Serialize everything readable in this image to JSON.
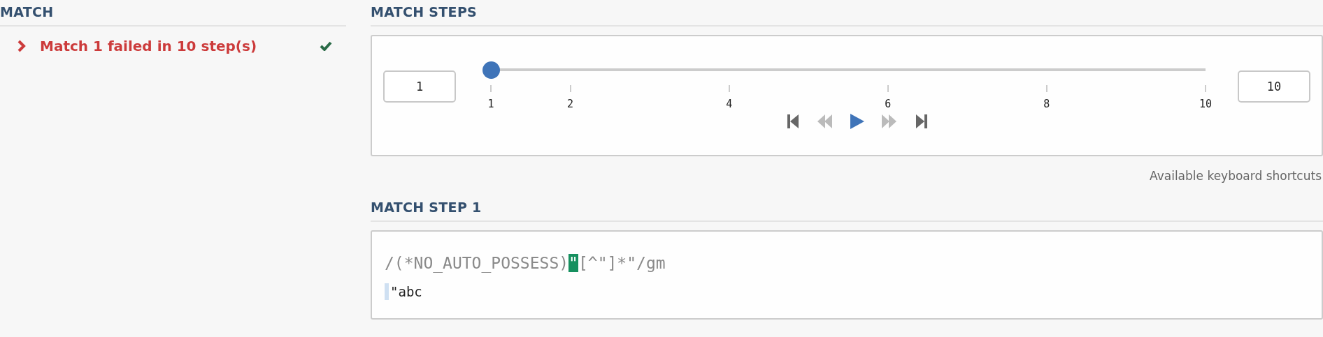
{
  "match_panel": {
    "title": "MATCH",
    "items": [
      {
        "label": "Match 1 failed in 10 step(s)",
        "expanded": false,
        "checked": true
      }
    ]
  },
  "steps_panel": {
    "title": "MATCH STEPS",
    "start_value": "1",
    "end_value": "10",
    "slider": {
      "level": 0,
      "ticks": [
        "1",
        "2",
        "4",
        "6",
        "8",
        "10"
      ]
    },
    "controls": [
      {
        "kind": "first",
        "disabled": false
      },
      {
        "kind": "previous",
        "disabled": true
      },
      {
        "kind": "play",
        "disabled": false
      },
      {
        "kind": "next",
        "disabled": true
      },
      {
        "kind": "last",
        "disabled": false
      }
    ],
    "shortcuts_link": "Available keyboard shortcuts"
  },
  "step_panel": {
    "title": "MATCH STEP 1",
    "regex": [
      {
        "text": "/(*NO_AUTO_POSSESS)",
        "highlighted": false
      },
      {
        "text": "\"",
        "highlighted": true
      },
      {
        "text": "[^\"]*\"/gm",
        "highlighted": false
      }
    ],
    "subject": "\"abc",
    "cursor_at_start": true
  }
}
